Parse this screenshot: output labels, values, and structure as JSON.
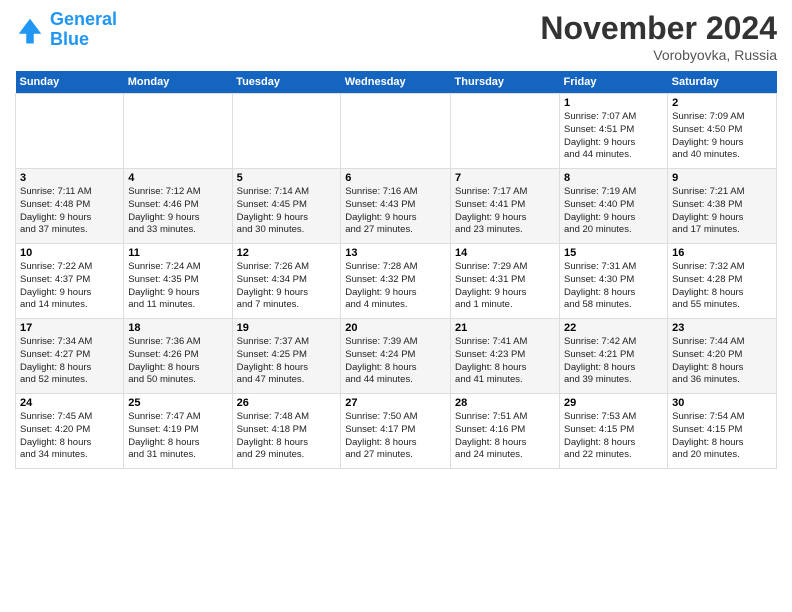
{
  "logo": {
    "line1": "General",
    "line2": "Blue"
  },
  "title": "November 2024",
  "location": "Vorobyovka, Russia",
  "days_of_week": [
    "Sunday",
    "Monday",
    "Tuesday",
    "Wednesday",
    "Thursday",
    "Friday",
    "Saturday"
  ],
  "weeks": [
    [
      {
        "day": "",
        "info": ""
      },
      {
        "day": "",
        "info": ""
      },
      {
        "day": "",
        "info": ""
      },
      {
        "day": "",
        "info": ""
      },
      {
        "day": "",
        "info": ""
      },
      {
        "day": "1",
        "info": "Sunrise: 7:07 AM\nSunset: 4:51 PM\nDaylight: 9 hours\nand 44 minutes."
      },
      {
        "day": "2",
        "info": "Sunrise: 7:09 AM\nSunset: 4:50 PM\nDaylight: 9 hours\nand 40 minutes."
      }
    ],
    [
      {
        "day": "3",
        "info": "Sunrise: 7:11 AM\nSunset: 4:48 PM\nDaylight: 9 hours\nand 37 minutes."
      },
      {
        "day": "4",
        "info": "Sunrise: 7:12 AM\nSunset: 4:46 PM\nDaylight: 9 hours\nand 33 minutes."
      },
      {
        "day": "5",
        "info": "Sunrise: 7:14 AM\nSunset: 4:45 PM\nDaylight: 9 hours\nand 30 minutes."
      },
      {
        "day": "6",
        "info": "Sunrise: 7:16 AM\nSunset: 4:43 PM\nDaylight: 9 hours\nand 27 minutes."
      },
      {
        "day": "7",
        "info": "Sunrise: 7:17 AM\nSunset: 4:41 PM\nDaylight: 9 hours\nand 23 minutes."
      },
      {
        "day": "8",
        "info": "Sunrise: 7:19 AM\nSunset: 4:40 PM\nDaylight: 9 hours\nand 20 minutes."
      },
      {
        "day": "9",
        "info": "Sunrise: 7:21 AM\nSunset: 4:38 PM\nDaylight: 9 hours\nand 17 minutes."
      }
    ],
    [
      {
        "day": "10",
        "info": "Sunrise: 7:22 AM\nSunset: 4:37 PM\nDaylight: 9 hours\nand 14 minutes."
      },
      {
        "day": "11",
        "info": "Sunrise: 7:24 AM\nSunset: 4:35 PM\nDaylight: 9 hours\nand 11 minutes."
      },
      {
        "day": "12",
        "info": "Sunrise: 7:26 AM\nSunset: 4:34 PM\nDaylight: 9 hours\nand 7 minutes."
      },
      {
        "day": "13",
        "info": "Sunrise: 7:28 AM\nSunset: 4:32 PM\nDaylight: 9 hours\nand 4 minutes."
      },
      {
        "day": "14",
        "info": "Sunrise: 7:29 AM\nSunset: 4:31 PM\nDaylight: 9 hours\nand 1 minute."
      },
      {
        "day": "15",
        "info": "Sunrise: 7:31 AM\nSunset: 4:30 PM\nDaylight: 8 hours\nand 58 minutes."
      },
      {
        "day": "16",
        "info": "Sunrise: 7:32 AM\nSunset: 4:28 PM\nDaylight: 8 hours\nand 55 minutes."
      }
    ],
    [
      {
        "day": "17",
        "info": "Sunrise: 7:34 AM\nSunset: 4:27 PM\nDaylight: 8 hours\nand 52 minutes."
      },
      {
        "day": "18",
        "info": "Sunrise: 7:36 AM\nSunset: 4:26 PM\nDaylight: 8 hours\nand 50 minutes."
      },
      {
        "day": "19",
        "info": "Sunrise: 7:37 AM\nSunset: 4:25 PM\nDaylight: 8 hours\nand 47 minutes."
      },
      {
        "day": "20",
        "info": "Sunrise: 7:39 AM\nSunset: 4:24 PM\nDaylight: 8 hours\nand 44 minutes."
      },
      {
        "day": "21",
        "info": "Sunrise: 7:41 AM\nSunset: 4:23 PM\nDaylight: 8 hours\nand 41 minutes."
      },
      {
        "day": "22",
        "info": "Sunrise: 7:42 AM\nSunset: 4:21 PM\nDaylight: 8 hours\nand 39 minutes."
      },
      {
        "day": "23",
        "info": "Sunrise: 7:44 AM\nSunset: 4:20 PM\nDaylight: 8 hours\nand 36 minutes."
      }
    ],
    [
      {
        "day": "24",
        "info": "Sunrise: 7:45 AM\nSunset: 4:20 PM\nDaylight: 8 hours\nand 34 minutes."
      },
      {
        "day": "25",
        "info": "Sunrise: 7:47 AM\nSunset: 4:19 PM\nDaylight: 8 hours\nand 31 minutes."
      },
      {
        "day": "26",
        "info": "Sunrise: 7:48 AM\nSunset: 4:18 PM\nDaylight: 8 hours\nand 29 minutes."
      },
      {
        "day": "27",
        "info": "Sunrise: 7:50 AM\nSunset: 4:17 PM\nDaylight: 8 hours\nand 27 minutes."
      },
      {
        "day": "28",
        "info": "Sunrise: 7:51 AM\nSunset: 4:16 PM\nDaylight: 8 hours\nand 24 minutes."
      },
      {
        "day": "29",
        "info": "Sunrise: 7:53 AM\nSunset: 4:15 PM\nDaylight: 8 hours\nand 22 minutes."
      },
      {
        "day": "30",
        "info": "Sunrise: 7:54 AM\nSunset: 4:15 PM\nDaylight: 8 hours\nand 20 minutes."
      }
    ]
  ]
}
